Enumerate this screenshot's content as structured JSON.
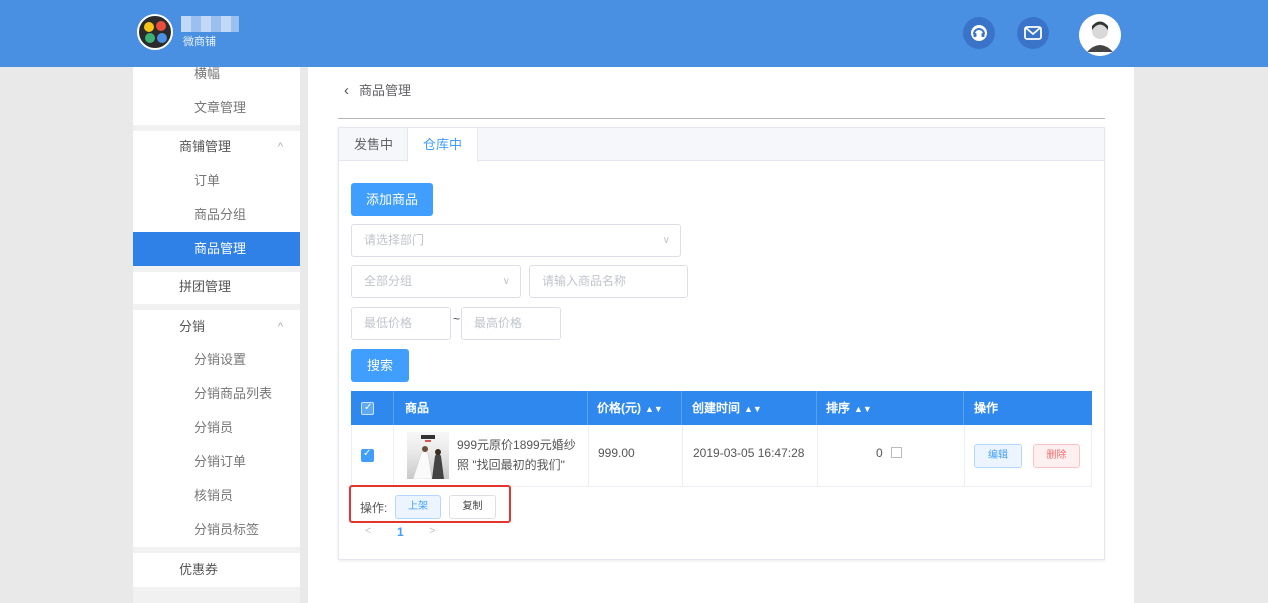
{
  "header": {
    "brand_name": "微商铺",
    "colors": {
      "bar": "#4a90e2",
      "accent": "#409eff",
      "highlight": "#e3342f"
    },
    "icons": [
      "headset-icon",
      "mail-icon",
      "user-avatar"
    ]
  },
  "sidebar": {
    "items": [
      {
        "label": "横幅",
        "type": "sub"
      },
      {
        "label": "文章管理",
        "type": "sub"
      },
      {
        "label": "商铺管理",
        "type": "group",
        "chevron": "^"
      },
      {
        "label": "订单",
        "type": "sub"
      },
      {
        "label": "商品分组",
        "type": "sub"
      },
      {
        "label": "商品管理",
        "type": "sub",
        "active": true
      },
      {
        "label": "拼团管理",
        "type": "group"
      },
      {
        "label": "分销",
        "type": "group",
        "chevron": "^"
      },
      {
        "label": "分销设置",
        "type": "sub"
      },
      {
        "label": "分销商品列表",
        "type": "sub"
      },
      {
        "label": "分销员",
        "type": "sub"
      },
      {
        "label": "分销订单",
        "type": "sub"
      },
      {
        "label": "核销员",
        "type": "sub"
      },
      {
        "label": "分销员标签",
        "type": "sub"
      },
      {
        "label": "优惠券",
        "type": "group"
      }
    ]
  },
  "main": {
    "breadcrumb": "商品管理",
    "tabs": [
      {
        "label": "发售中",
        "active": false
      },
      {
        "label": "仓库中",
        "active": true
      }
    ],
    "add_button": "添加商品",
    "department_placeholder": "请选择部门",
    "group_placeholder": "全部分组",
    "name_placeholder": "请输入商品名称",
    "min_price_placeholder": "最低价格",
    "max_price_placeholder": "最高价格",
    "range_separator": "~",
    "search_button": "搜索",
    "table": {
      "columns": [
        "商品",
        "价格(元)",
        "创建时间",
        "排序",
        "操作"
      ],
      "rows": [
        {
          "checked": true,
          "name": "999元原价1899元婚纱照 \"找回最初的我们\"",
          "price": "999.00",
          "created": "2019-03-05 16:47:28",
          "sort": "0",
          "edit_label": "编辑",
          "delete_label": "删除"
        }
      ]
    },
    "bulk": {
      "label": "操作:",
      "shelve_label": "上架",
      "copy_label": "复制"
    },
    "pagination": {
      "prev": "<",
      "current": "1",
      "next": ">"
    }
  }
}
